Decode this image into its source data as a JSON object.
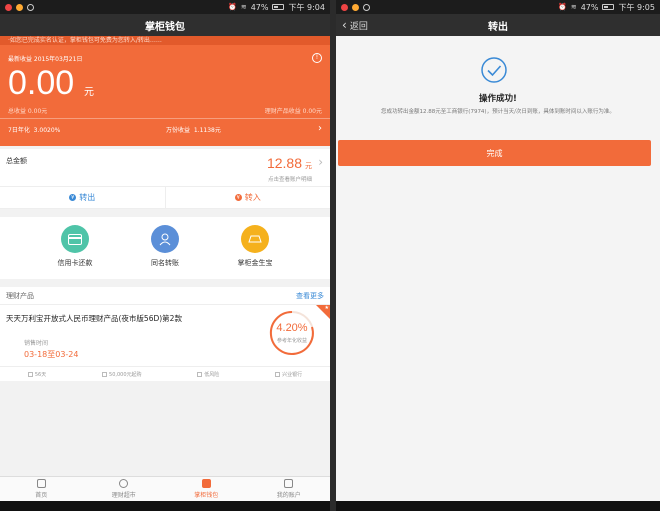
{
  "left": {
    "status": {
      "battery": "47%",
      "time": "下午 9:04"
    },
    "title": "掌柜钱包",
    "ticker": "·如您已完成实名认证，掌柜钱包可免费为您转入/转出……",
    "earnings": {
      "label": "最新收益  2015年03月21日",
      "info": "!",
      "amount": "0.00",
      "unit": "元",
      "left_note": "总收益  0.00元",
      "right_note": "理财产品收益 0.00元",
      "rate_label": "7日年化",
      "rate_value": "3.0020%",
      "wan_label": "万份收益",
      "wan_value": "1.1138元",
      "chevron": "›"
    },
    "total": {
      "label": "总金额",
      "amount": "12.88",
      "unit": "元",
      "hint": "点击查看账户明细",
      "chevron": "›"
    },
    "actions": {
      "out": {
        "icon": "¥",
        "label": "转出"
      },
      "in": {
        "icon": "¥",
        "label": "转入"
      }
    },
    "services": [
      {
        "label": "信用卡还款",
        "color": "#4fc4a8",
        "icon": "credit-card-icon"
      },
      {
        "label": "同名转账",
        "color": "#5b8fd8",
        "icon": "user-transfer-icon"
      },
      {
        "label": "掌柜金生宝",
        "color": "#f5b11d",
        "icon": "gold-icon"
      }
    ],
    "products": {
      "title": "理财产品",
      "more": "查看更多",
      "name": "天天万利宝开放式人民币理财产品(夜市版56D)第2款",
      "sale_label": "销售时间",
      "sale_date": "03-18至03-24",
      "rate": "4.20%",
      "rate_sub": "参考年化收益",
      "corner": "★",
      "footer": [
        "56天",
        "50,000元起购",
        "低风险",
        "兴业银行"
      ]
    },
    "tabs": [
      {
        "label": "首页",
        "active": false
      },
      {
        "label": "理财超市",
        "active": false
      },
      {
        "label": "掌柜钱包",
        "active": true
      },
      {
        "label": "我的账户",
        "active": false
      }
    ]
  },
  "right": {
    "status": {
      "battery": "47%",
      "time": "下午 9:05"
    },
    "title": "转出",
    "back": {
      "chevron": "‹",
      "label": "返回"
    },
    "success_title": "操作成功!",
    "success_msg": "您成功转出金额12.88元至工商银行(7974)，预计当天/次日到账，具体到账时间以入账行为准。",
    "done": "完成"
  },
  "colors": {
    "accent": "#f26b3a",
    "link": "#3a8ad6"
  }
}
